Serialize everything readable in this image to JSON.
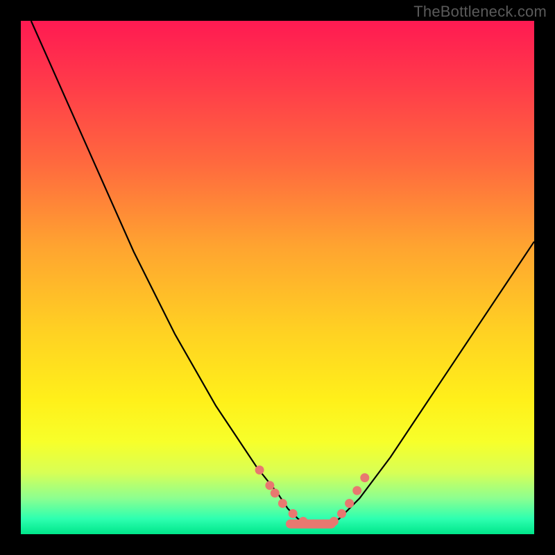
{
  "watermark": "TheBottleneck.com",
  "colors": {
    "frame": "#000000",
    "curve": "#000000",
    "marker": "#e87870"
  },
  "chart_data": {
    "type": "line",
    "title": "",
    "xlabel": "",
    "ylabel": "",
    "xlim": [
      0,
      100
    ],
    "ylim": [
      0,
      100
    ],
    "grid": false,
    "legend": false,
    "series": [
      {
        "name": "bottleneck-curve",
        "x": [
          2,
          6,
          10,
          14,
          18,
          22,
          26,
          30,
          34,
          38,
          42,
          46,
          50,
          52,
          54,
          56,
          58,
          60,
          62,
          66,
          72,
          78,
          84,
          90,
          96,
          100
        ],
        "y": [
          100,
          91,
          82,
          73,
          64,
          55,
          47,
          39,
          32,
          25,
          19,
          13,
          8,
          5,
          3,
          2,
          1.5,
          2,
          3,
          7,
          15,
          24,
          33,
          42,
          51,
          57
        ]
      }
    ],
    "markers": {
      "name": "highlight-dots",
      "x": [
        46.5,
        48.5,
        49.5,
        51,
        53,
        55,
        57,
        59,
        61,
        62.5,
        64,
        65.5,
        67
      ],
      "y": [
        12.5,
        9.5,
        8,
        6,
        4,
        2.5,
        2,
        2,
        2.5,
        4,
        6,
        8.5,
        11
      ]
    },
    "flat_segment": {
      "x": [
        52.5,
        60.5
      ],
      "y": [
        2,
        2
      ]
    }
  }
}
